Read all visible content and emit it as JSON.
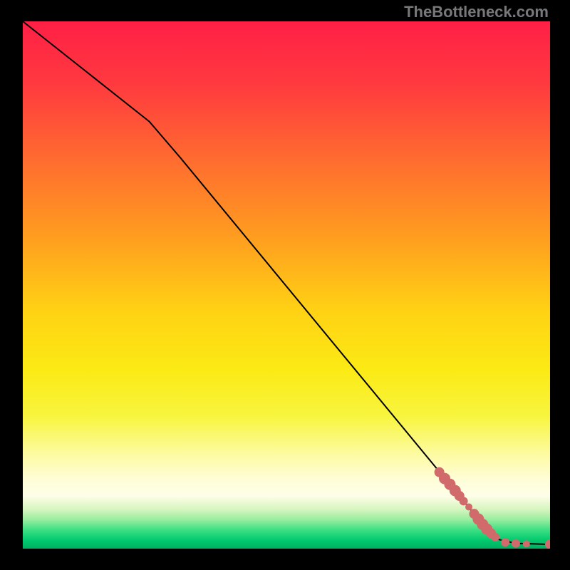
{
  "watermark": "TheBottleneck.com",
  "chart_data": {
    "type": "line",
    "xlabel": "",
    "ylabel": "",
    "xlim": [
      0,
      100
    ],
    "ylim": [
      0,
      100
    ],
    "grid": false,
    "background_gradient": {
      "stops": [
        {
          "pos": 0.0,
          "color": "#ff1f46"
        },
        {
          "pos": 0.12,
          "color": "#ff3a3f"
        },
        {
          "pos": 0.26,
          "color": "#ff6b30"
        },
        {
          "pos": 0.4,
          "color": "#ff9a20"
        },
        {
          "pos": 0.55,
          "color": "#ffd214"
        },
        {
          "pos": 0.66,
          "color": "#fbea14"
        },
        {
          "pos": 0.75,
          "color": "#f8f540"
        },
        {
          "pos": 0.82,
          "color": "#fdfba0"
        },
        {
          "pos": 0.87,
          "color": "#fefdd8"
        },
        {
          "pos": 0.9,
          "color": "#fefee8"
        },
        {
          "pos": 0.925,
          "color": "#d8f5c0"
        },
        {
          "pos": 0.945,
          "color": "#98eda0"
        },
        {
          "pos": 0.965,
          "color": "#3adf82"
        },
        {
          "pos": 0.985,
          "color": "#00c86e"
        },
        {
          "pos": 1.0,
          "color": "#00b060"
        }
      ]
    },
    "series": [
      {
        "name": "curve",
        "stroke": "#000000",
        "stroke_width": 2,
        "points": [
          {
            "x": 0.0,
            "y": 100.0
          },
          {
            "x": 24.0,
            "y": 81.0
          },
          {
            "x": 30.0,
            "y": 74.0
          },
          {
            "x": 86.5,
            "y": 5.5
          },
          {
            "x": 90.0,
            "y": 1.8
          },
          {
            "x": 93.5,
            "y": 1.0
          },
          {
            "x": 100.0,
            "y": 0.8
          }
        ]
      }
    ],
    "markers": {
      "color": "#d16a6a",
      "points": [
        {
          "x": 79.0,
          "y": 14.5,
          "r": 7
        },
        {
          "x": 80.0,
          "y": 13.3,
          "r": 8
        },
        {
          "x": 81.0,
          "y": 12.2,
          "r": 8
        },
        {
          "x": 82.0,
          "y": 11.0,
          "r": 8
        },
        {
          "x": 82.8,
          "y": 10.0,
          "r": 7
        },
        {
          "x": 83.6,
          "y": 9.0,
          "r": 6
        },
        {
          "x": 84.6,
          "y": 7.9,
          "r": 5
        },
        {
          "x": 85.6,
          "y": 6.6,
          "r": 7
        },
        {
          "x": 86.4,
          "y": 5.6,
          "r": 8
        },
        {
          "x": 87.2,
          "y": 4.6,
          "r": 8
        },
        {
          "x": 88.0,
          "y": 3.7,
          "r": 8
        },
        {
          "x": 88.8,
          "y": 2.9,
          "r": 7
        },
        {
          "x": 89.6,
          "y": 2.2,
          "r": 6
        },
        {
          "x": 91.5,
          "y": 1.2,
          "r": 6
        },
        {
          "x": 93.5,
          "y": 1.0,
          "r": 6
        },
        {
          "x": 95.5,
          "y": 0.9,
          "r": 5
        },
        {
          "x": 100.0,
          "y": 0.8,
          "r": 7
        }
      ]
    }
  }
}
